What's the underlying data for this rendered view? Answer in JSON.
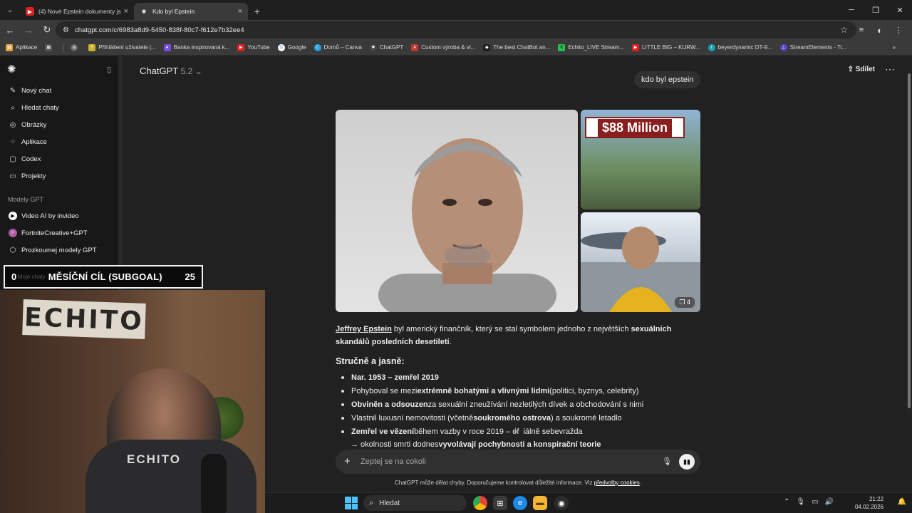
{
  "browser": {
    "tabs": [
      {
        "title": "(4) Nové Epstein dokumenty js",
        "icon": "youtube-icon",
        "active": false
      },
      {
        "title": "Kdo byl Epstein",
        "icon": "chatgpt-icon",
        "active": true
      }
    ],
    "url": "chatgpt.com/c/6983a8d9-5450-838f-80c7-f612e7b32ee4",
    "bookmarks": [
      {
        "label": "Aplikace",
        "color": "#e8a13a"
      },
      {
        "label": "Přihlášení uživatele |...",
        "color": "#c9b227"
      },
      {
        "label": "Banka inspirovaná k...",
        "color": "#7a4be0"
      },
      {
        "label": "YouTube",
        "color": "#e02020"
      },
      {
        "label": "Google",
        "color": "#4285f4"
      },
      {
        "label": "Domů – Canva",
        "color": "#1fa3d9"
      },
      {
        "label": "ChatGPT",
        "color": "#444444"
      },
      {
        "label": "Custom výroba & vl...",
        "color": "#c0392b"
      },
      {
        "label": "The best ChatBot an...",
        "color": "#222222"
      },
      {
        "label": "Echito_LIVE Stream...",
        "color": "#25c04b"
      },
      {
        "label": "LITTLE BIG – KURW...",
        "color": "#e02020"
      },
      {
        "label": "beyerdynamic DT-9...",
        "color": "#17a2b8"
      },
      {
        "label": "StreamElements - Ti...",
        "color": "#5b3bd6"
      }
    ]
  },
  "sidebar": {
    "items": [
      {
        "label": "Nový chat",
        "icon": "pencil-icon"
      },
      {
        "label": "Hledat chaty",
        "icon": "search-icon"
      },
      {
        "label": "Obrázky",
        "icon": "image-icon"
      },
      {
        "label": "Aplikace",
        "icon": "apps-icon"
      },
      {
        "label": "Codex",
        "icon": "code-icon"
      },
      {
        "label": "Projekty",
        "icon": "folder-icon"
      }
    ],
    "gpt_heading": "Modely GPT",
    "gpts": [
      {
        "label": "Video AI by invideo",
        "icon": "video-ai-icon"
      },
      {
        "label": "FortniteCreative+GPT",
        "icon": "fortnite-icon"
      },
      {
        "label": "Prozkoumej modely GPT",
        "icon": "cube-icon"
      }
    ],
    "chats_heading": "Moje chaty"
  },
  "header": {
    "model_name": "ChatGPT",
    "model_version": "5.2",
    "share_label": "Sdílet"
  },
  "conversation": {
    "user_message": "kdo byl epstein",
    "image_overlay_price": "$88 Million",
    "image_count_badge": "4",
    "intro": {
      "name": "Jeffrey Epstein",
      "text1": " byl americký finančník, který se stal symbolem jednoho z největších ",
      "bold1": "sexuálních skandálů",
      "bold2": "posledních desetiletí",
      "end": "."
    },
    "summary_heading": "Stručně a jasně:",
    "bullets": [
      {
        "parts": [
          [
            "b",
            "Nar. 1953 – zemřel 2019"
          ]
        ]
      },
      {
        "parts": [
          [
            "t",
            "Pohyboval se mezi "
          ],
          [
            "b",
            "extrémně bohatými a vlivnými lidmi"
          ],
          [
            "t",
            " (politici, byznys, celebrity)"
          ]
        ]
      },
      {
        "parts": [
          [
            "b",
            "Obviněn a odsouzen"
          ],
          [
            "t",
            " za sexuální zneužívání nezletilých dívek a obchodování s nimi"
          ]
        ]
      },
      {
        "parts": [
          [
            "t",
            "Vlastnil luxusní nemovitosti (včetně "
          ],
          [
            "b",
            "soukromého ostrova"
          ],
          [
            "t",
            ") a soukromé letadlo"
          ]
        ]
      },
      {
        "parts": [
          [
            "b",
            "Zemřel ve vězení"
          ],
          [
            "t",
            " během vazby v roce 2019 – of"
          ],
          [
            "t",
            "iálně sebevražda"
          ]
        ]
      }
    ],
    "arrow_line": {
      "prefix": "→ okolnosti smrti dodnes ",
      "bold": "vyvolávají pochybnosti a konspirační teorie"
    }
  },
  "composer": {
    "placeholder": "Zeptej se na cokoli"
  },
  "footer": {
    "text": "ChatGPT může dělat chyby. Doporučujeme kontrolovat důležité informace. Viz ",
    "link": "předvolby cookies",
    "end": "."
  },
  "stream_overlay": {
    "left_value": "0",
    "title": "MĚSÍČNÍ CÍL (SUBGOAL)",
    "right_value": "25",
    "sign_text": "ECHITO",
    "shirt_text": "ECHITO"
  },
  "taskbar": {
    "search_label": "Hledat",
    "time": "21:22",
    "date": "04.02.2026"
  },
  "colors": {
    "background": "#212121",
    "sidebar": "#181818",
    "accent_start": "#4cc2ff"
  }
}
